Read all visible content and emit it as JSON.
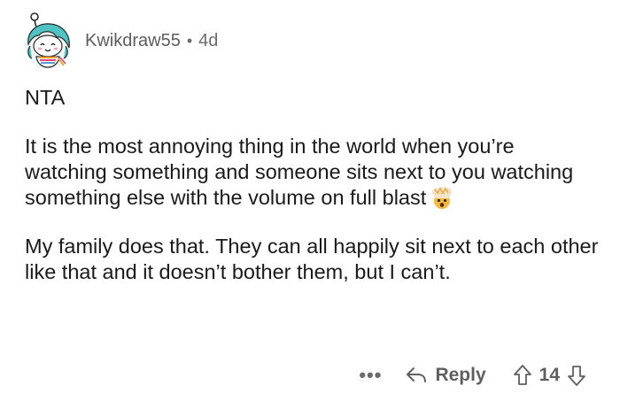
{
  "comment": {
    "username": "Kwikdraw55",
    "separator": "•",
    "age": "4d",
    "paragraphs": [
      "NTA",
      "It is the most annoying thing in the world when you’re watching something and someone sits next to you watching something else with the volume on full blast",
      "My family does that. They can all happily sit next to each other like that and it doesn’t bother them, but I can’t."
    ],
    "inline_emoji": "exploding-head-emoji",
    "actions": {
      "more_label": "•••",
      "reply_label": "Reply",
      "vote_count": "14"
    }
  },
  "colors": {
    "avatar_hair": "#4fc3c3",
    "text_primary": "#1a1a1a",
    "text_meta": "#6b6b6b"
  },
  "icons": {
    "reply": "reply-arrow-icon",
    "upvote": "upvote-arrow-icon",
    "downvote": "downvote-arrow-icon",
    "avatar": "snoo-avatar"
  }
}
